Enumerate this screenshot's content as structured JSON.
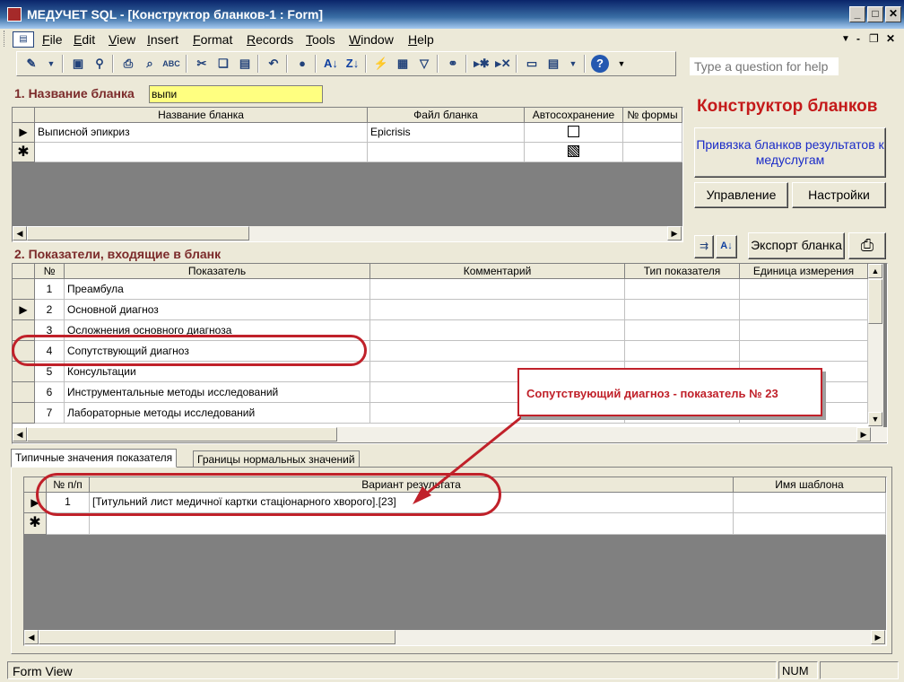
{
  "window": {
    "title": "МЕДУЧЕТ SQL - [Конструктор бланков-1 : Form]"
  },
  "menu": [
    "File",
    "Edit",
    "View",
    "Insert",
    "Format",
    "Records",
    "Tools",
    "Window",
    "Help"
  ],
  "help_box": {
    "placeholder": "Type a question for help"
  },
  "section1": {
    "label": "1. Название бланка",
    "filter_value": "выпи",
    "columns": [
      "Название бланка",
      "Файл бланка",
      "Автосохранение",
      "№ формы"
    ],
    "rows": [
      {
        "name": "Выписной эпикриз",
        "file": "Epicrisis",
        "autosave": false
      }
    ]
  },
  "right_panel": {
    "title": "Конструктор бланков",
    "link_button": "Привязка бланков результатов к медуслугам",
    "manage_button": "Управление",
    "settings_button": "Настройки",
    "export_button": "Экспорт бланка"
  },
  "section2": {
    "label": "2. Показатели, входящие в бланк",
    "columns": [
      "№",
      "Показатель",
      "Комментарий",
      "Тип показателя",
      "Единица измерения"
    ],
    "rows": [
      {
        "n": "1",
        "name": "Преамбула"
      },
      {
        "n": "2",
        "name": "Основной диагноз"
      },
      {
        "n": "3",
        "name": "Осложнения основного диагноза"
      },
      {
        "n": "4",
        "name": "Сопутствующий диагноз"
      },
      {
        "n": "5",
        "name": "Консультации"
      },
      {
        "n": "6",
        "name": "Инструментальные методы исследований"
      },
      {
        "n": "7",
        "name": "Лабораторные методы исследований"
      }
    ]
  },
  "tabs": [
    "Типичные значения показателя",
    "Границы нормальных значений"
  ],
  "section3": {
    "columns": [
      "№ п/п",
      "Вариант результата",
      "Имя шаблона"
    ],
    "rows": [
      {
        "n": "1",
        "value": "[Титульний лист медичної картки стаціонарного хворого].[23]",
        "template": ""
      }
    ]
  },
  "annotation": {
    "text": "Сопутствующий диагноз - показатель № 23",
    "color": "#c0212a"
  },
  "status": {
    "left": "Form View",
    "num": "NUM"
  }
}
